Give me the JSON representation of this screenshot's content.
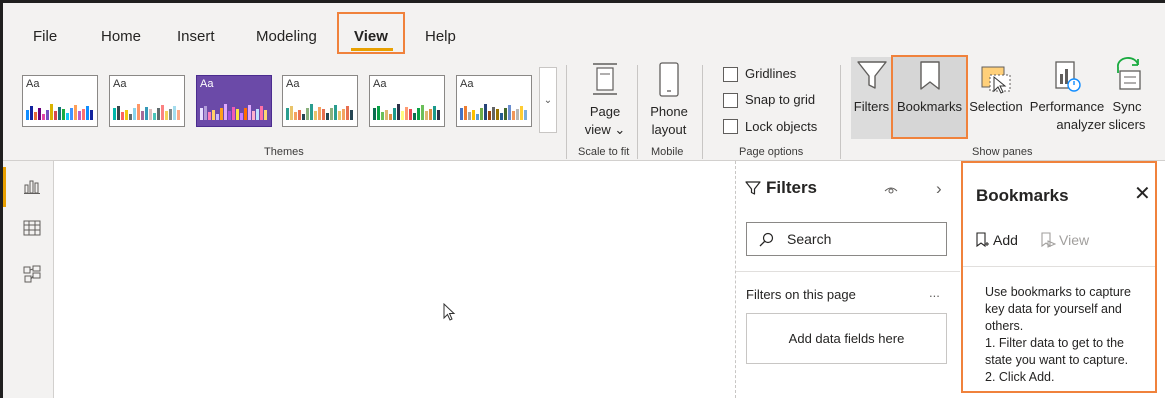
{
  "menu": {
    "items": [
      "File",
      "Home",
      "Insert",
      "Modeling",
      "View",
      "Help"
    ],
    "active": "View"
  },
  "themes": {
    "tiles": [
      "Aa",
      "Aa",
      "Aa",
      "Aa",
      "Aa",
      "Aa"
    ],
    "selected_index": 2,
    "group_label": "Themes",
    "scroll_glyph": "⌄"
  },
  "scale_to_fit": {
    "button_label_line1": "Page",
    "button_label_line2": "view ⌄",
    "group_label": "Scale to fit"
  },
  "mobile": {
    "button_label_line1": "Phone",
    "button_label_line2": "layout",
    "group_label": "Mobile"
  },
  "page_options": {
    "gridlines": "Gridlines",
    "snap_to_grid": "Snap to grid",
    "lock_objects": "Lock objects",
    "group_label": "Page options"
  },
  "show_panes": {
    "filters": "Filters",
    "bookmarks": "Bookmarks",
    "selection": "Selection",
    "performance_line1": "Performance",
    "performance_line2": "analyzer",
    "sync_line1": "Sync",
    "sync_line2": "slicers",
    "group_label": "Show panes"
  },
  "filters_pane": {
    "title": "Filters",
    "search_placeholder": "Search",
    "section_label": "Filters on this page",
    "more_glyph": "...",
    "drop_zone": "Add data fields here"
  },
  "bookmarks_pane": {
    "title": "Bookmarks",
    "add_label": "Add",
    "view_label": "View",
    "help_line1": "Use bookmarks to capture",
    "help_line2": "key data for yourself and",
    "help_line3": "others.",
    "help_line4": "1. Filter data to get to the",
    "help_line5": "state you want to capture.",
    "help_line6": "2. Click Add."
  },
  "colors": {
    "accent_orange": "#f0823c",
    "active_underline": "#e8a000",
    "selected_theme": "#6b4aa8"
  }
}
